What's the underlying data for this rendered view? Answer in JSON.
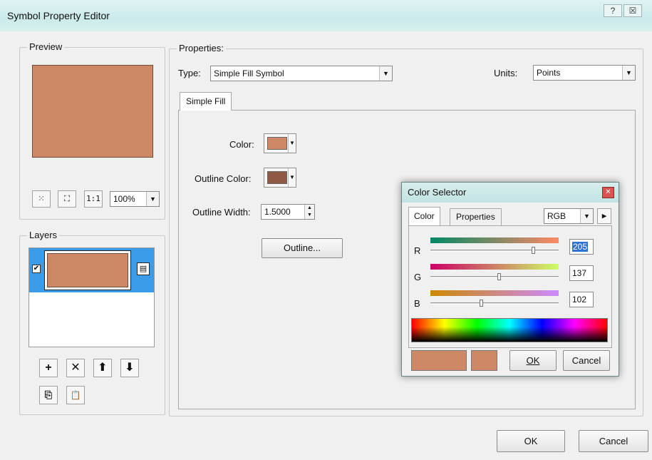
{
  "window": {
    "title": "Symbol Property Editor",
    "help_glyph": "?",
    "close_glyph": "☒"
  },
  "preview": {
    "legend": "Preview",
    "zoom_value": "100%",
    "tools": [
      "fit-icon",
      "expand-icon",
      "one-to-one-icon"
    ],
    "tool_glyphs": [
      "⁙",
      "⛶",
      "1:1"
    ]
  },
  "layers": {
    "legend": "Layers",
    "check_glyph": "✔",
    "lock_glyph": "▤",
    "buttons": {
      "add": "+",
      "remove": "✕",
      "up": "⬆",
      "down": "⬇",
      "copy": "⎘",
      "paste": "📋"
    }
  },
  "properties": {
    "legend": "Properties:",
    "type_label": "Type:",
    "type_value": "Simple Fill Symbol",
    "units_label": "Units:",
    "units_value": "Points",
    "tab_label": "Simple Fill",
    "color_label": "Color:",
    "outline_color_label": "Outline Color:",
    "outline_width_label": "Outline Width:",
    "outline_width_value": "1.5000",
    "outline_button": "Outline..."
  },
  "colors": {
    "fill": "#cd8966",
    "outline": "#8e5a45"
  },
  "color_selector": {
    "title": "Color Selector",
    "close_glyph": "✕",
    "tab_color": "Color",
    "tab_properties": "Properties",
    "model": "RGB",
    "channels": [
      {
        "label": "R",
        "value": "205",
        "fraction": 0.804
      },
      {
        "label": "G",
        "value": "137",
        "fraction": 0.537
      },
      {
        "label": "B",
        "value": "102",
        "fraction": 0.4
      }
    ],
    "ok_label": "OK",
    "cancel_label": "Cancel"
  },
  "footer": {
    "ok_label": "OK",
    "cancel_label": "Cancel"
  }
}
